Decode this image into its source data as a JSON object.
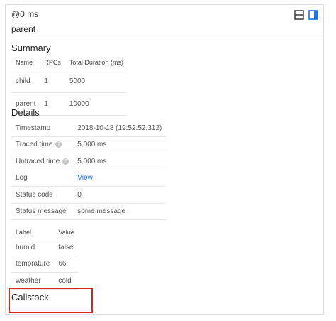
{
  "header": {
    "time": "@0 ms",
    "name": "parent",
    "split_horizontal_icon": "split-horizontal-icon",
    "split_vertical_icon": "split-vertical-icon",
    "active_color": "#1a73e8",
    "inactive_color": "#444444"
  },
  "summary": {
    "title": "Summary",
    "columns": [
      "Name",
      "RPCs",
      "Total Duration (ms)"
    ],
    "rows": [
      [
        "child",
        "1",
        "5000"
      ],
      [
        "parent",
        "1",
        "10000"
      ]
    ]
  },
  "details": {
    "title": "Details",
    "rows": [
      {
        "key": "Timestamp",
        "value": "2018-10-18 (19:52:52.312)"
      },
      {
        "key": "Traced time",
        "value": "5,000 ms",
        "help": "?"
      },
      {
        "key": "Untraced time",
        "value": "5,000 ms",
        "help": "?"
      },
      {
        "key": "Log",
        "value": "View"
      },
      {
        "key": "Status code",
        "value": "0"
      },
      {
        "key": "Status message",
        "value": "some message"
      }
    ]
  },
  "labels": {
    "columns": [
      "Label",
      "Value"
    ],
    "rows": [
      [
        "humid",
        "false"
      ],
      [
        "temprature",
        "66"
      ],
      [
        "weather",
        "cold"
      ]
    ]
  },
  "callstack": {
    "title": "Callstack",
    "highlight_color": "#e0201b"
  }
}
